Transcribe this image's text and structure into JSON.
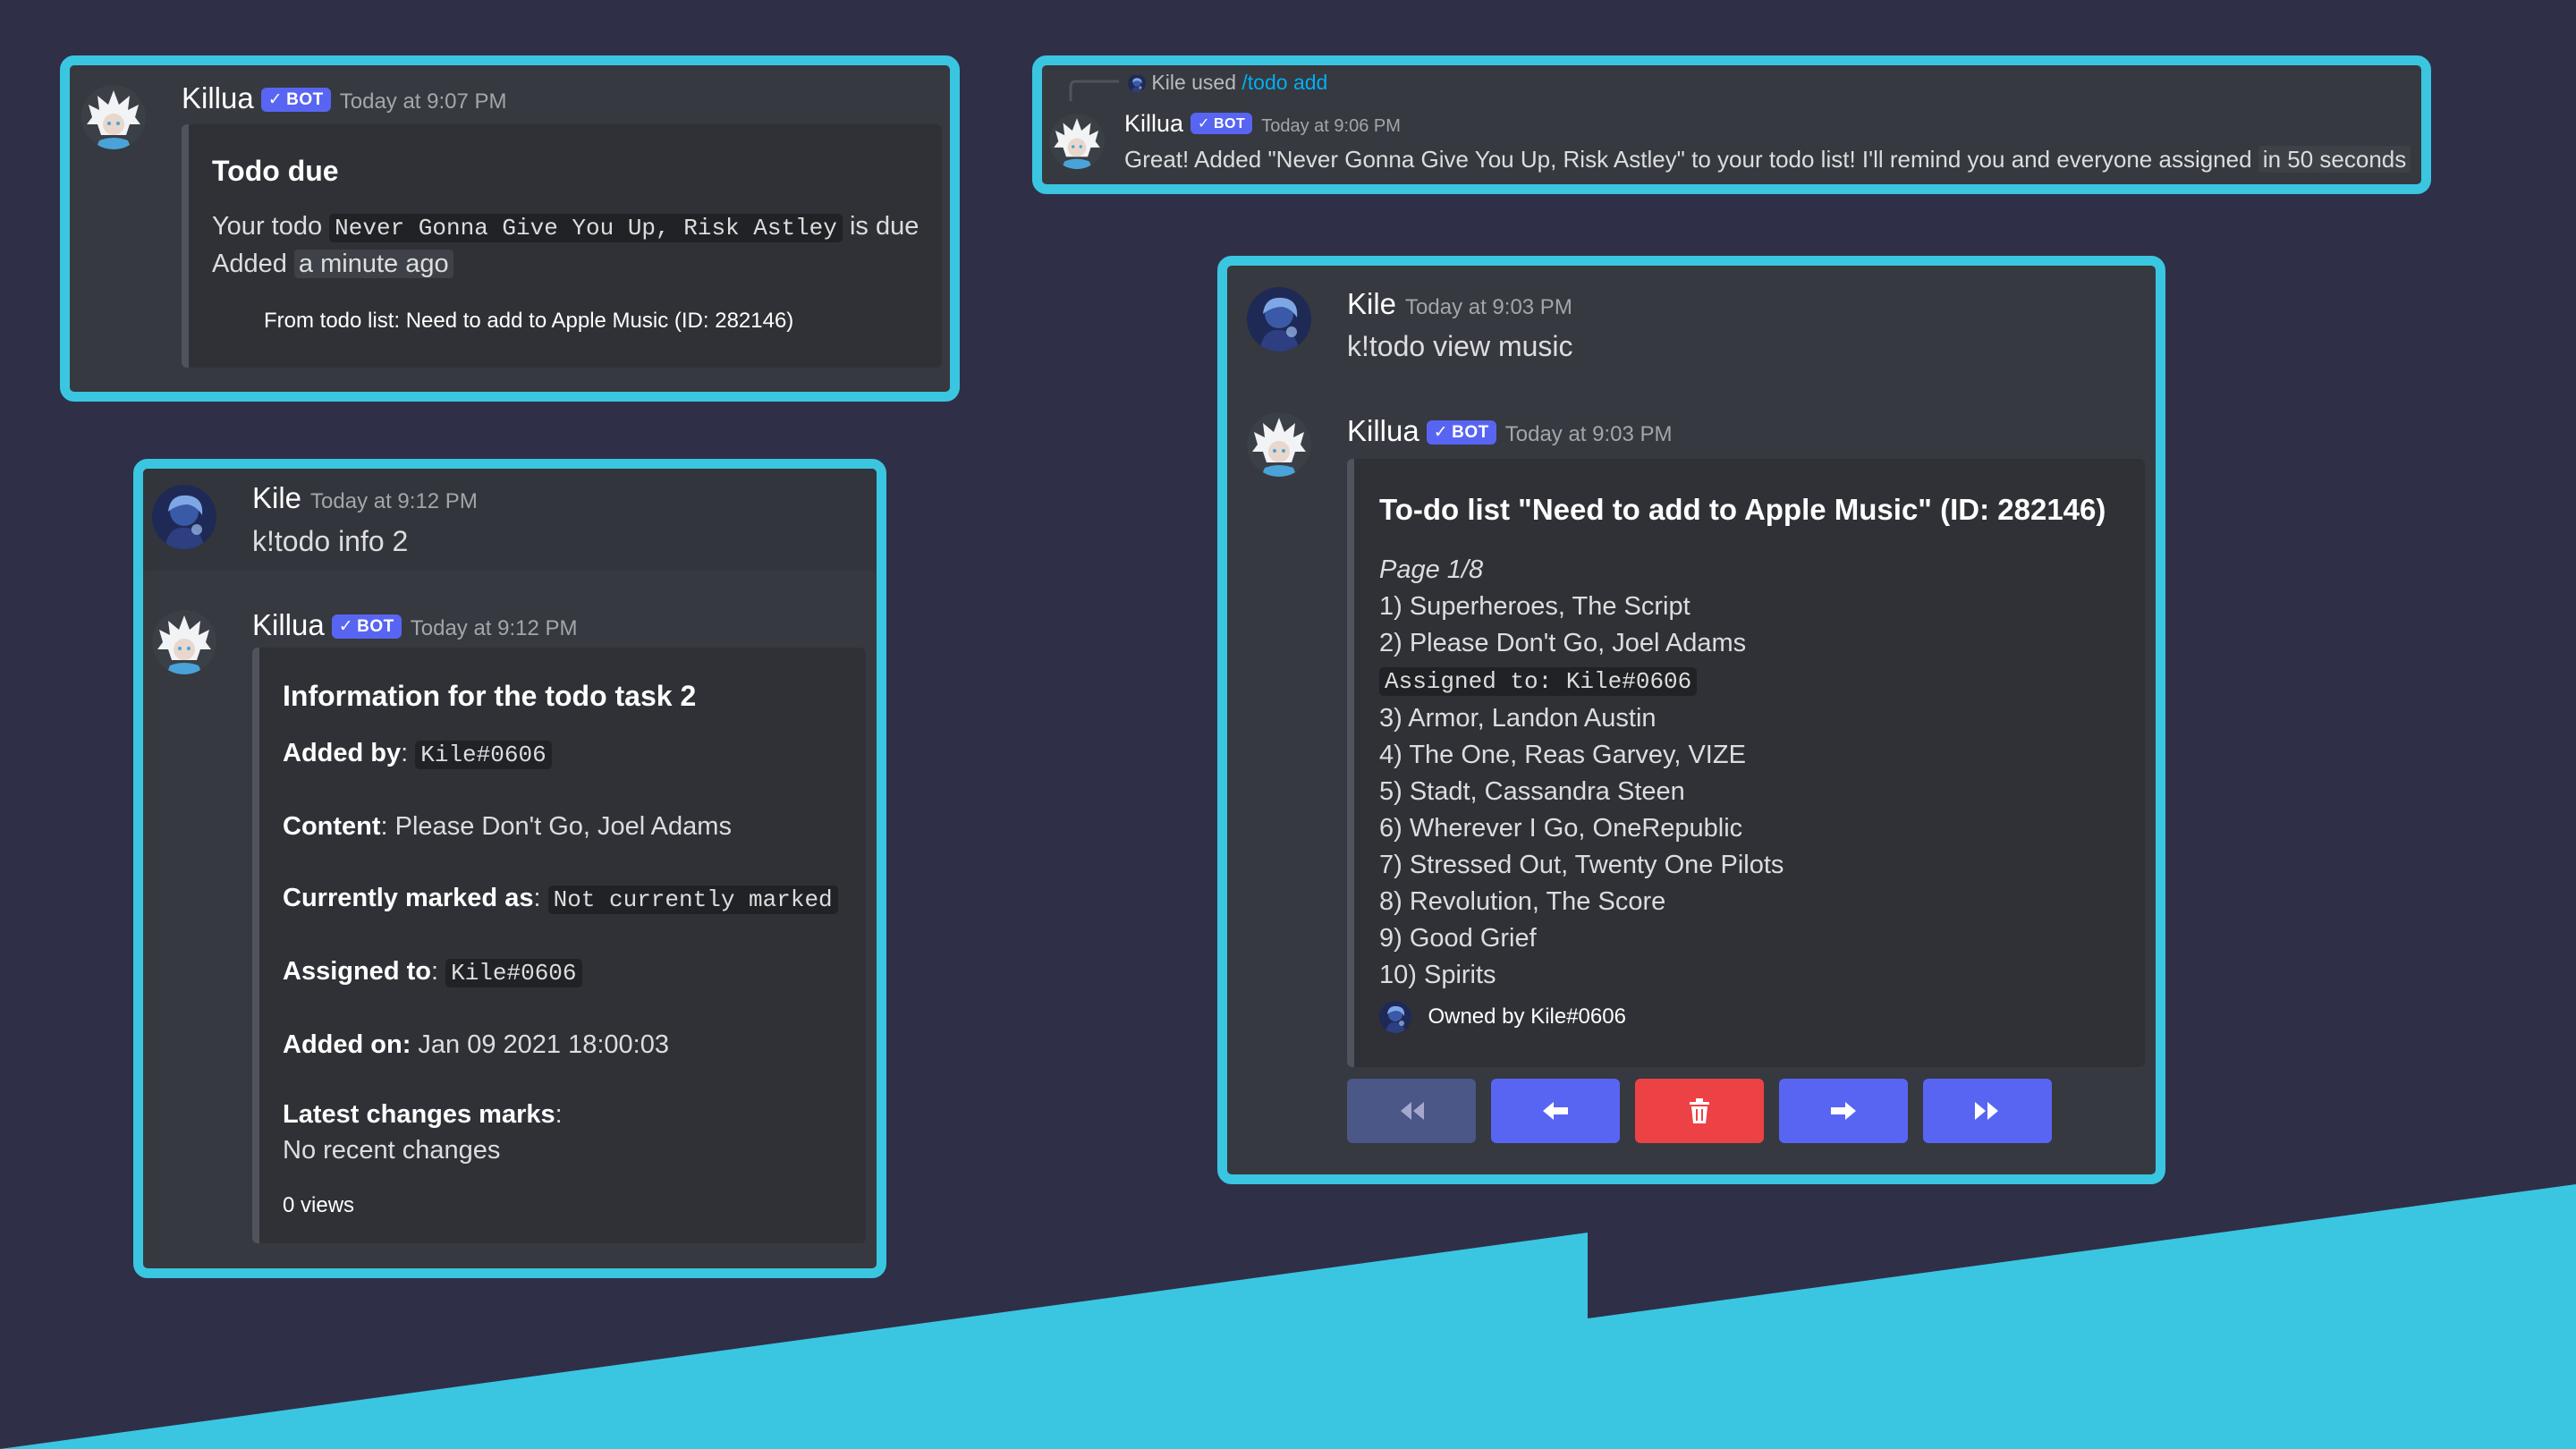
{
  "colors": {
    "accent": "#3ac6e1",
    "background": "#2f2f48",
    "bot_badge": "#5865f2",
    "danger": "#ed4245"
  },
  "card1": {
    "username": "Killua",
    "bot_label": "BOT",
    "timestamp": "Today at 9:07 PM",
    "embed_title": "Todo due",
    "line1_prefix": "Your todo",
    "line1_code": "Never Gonna Give You Up, Risk Astley",
    "line1_suffix": "is due",
    "line2_prefix": "Added",
    "line2_highlight": "a minute ago",
    "footer": "From todo list: Need to add to Apple Music (ID: 282146)"
  },
  "card2": {
    "reply_user": "Kile used",
    "reply_command": "/todo add",
    "username": "Killua",
    "bot_label": "BOT",
    "timestamp": "Today at 9:06 PM",
    "message_prefix": "Great! Added \"Never Gonna Give You Up, Risk Astley\" to your todo list! I'll remind you and everyone assigned",
    "message_highlight": "in 50 seconds"
  },
  "card3": {
    "user_msg": {
      "username": "Kile",
      "timestamp": "Today at 9:12 PM",
      "content": "k!todo info 2"
    },
    "bot_msg": {
      "username": "Killua",
      "bot_label": "BOT",
      "timestamp": "Today at 9:12 PM"
    },
    "embed_title": "Information for the todo task 2",
    "added_by_label": "Added by",
    "added_by_value": "Kile#0606",
    "content_label": "Content",
    "content_value": ": Please Don't Go, Joel Adams",
    "marked_label": "Currently marked as",
    "marked_value": "Not currently marked",
    "assigned_label": "Assigned to",
    "assigned_value": "Kile#0606",
    "added_on_label": "Added on:",
    "added_on_value": " Jan 09 2021 18:00:03",
    "latest_label": "Latest changes marks",
    "latest_value": "No recent changes",
    "footer": "0 views"
  },
  "card4": {
    "user_msg": {
      "username": "Kile",
      "timestamp": "Today at 9:03 PM",
      "content": "k!todo view music"
    },
    "bot_msg": {
      "username": "Killua",
      "bot_label": "BOT",
      "timestamp": "Today at 9:03 PM"
    },
    "embed_title": "To-do list \"Need to add to Apple Music\" (ID: 282146)",
    "page": "Page 1/8",
    "items": [
      "1) Superheroes, The Script",
      "2) Please Don't Go, Joel Adams",
      "3) Armor, Landon Austin",
      "4) The One, Reas Garvey, VIZE",
      "5) Stadt, Cassandra Steen",
      "6) Wherever I Go, OneRepublic",
      "7) Stressed Out, Twenty One Pilots",
      "8) Revolution, The Score",
      "9) Good Grief",
      "10) Spirits"
    ],
    "assigned_note": "Assigned to: Kile#0606",
    "footer": "Owned by Kile#0606",
    "buttons": [
      {
        "name": "first-page-button",
        "icon": "double-left-icon"
      },
      {
        "name": "previous-page-button",
        "icon": "arrow-left-icon"
      },
      {
        "name": "delete-button",
        "icon": "trash-icon"
      },
      {
        "name": "next-page-button",
        "icon": "arrow-right-icon"
      },
      {
        "name": "last-page-button",
        "icon": "double-right-icon"
      }
    ]
  }
}
